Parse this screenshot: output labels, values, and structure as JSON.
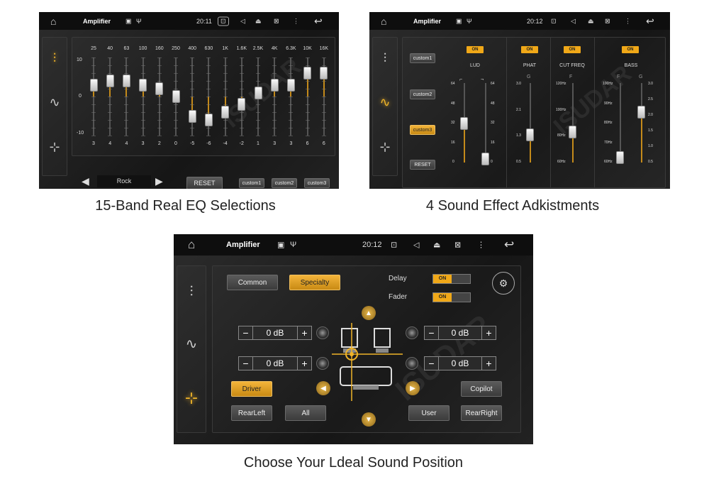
{
  "colors": {
    "accent": "#f0a818",
    "background": "#1c1c1c"
  },
  "panel1": {
    "status": {
      "title": "Amplifier",
      "time": "20:11",
      "home_icon": "home-icon",
      "back_icon": "back-icon"
    },
    "eq": {
      "frequencies": [
        "25",
        "40",
        "63",
        "100",
        "160",
        "250",
        "400",
        "630",
        "1K",
        "1.6K",
        "2.5K",
        "4K",
        "6.3K",
        "10K",
        "16K"
      ],
      "values": [
        3,
        4,
        4,
        3,
        2,
        0,
        -5,
        -6,
        -4,
        -2,
        1,
        3,
        3,
        6,
        6
      ],
      "value_labels": [
        "3",
        "4",
        "4",
        "3",
        "2",
        "0",
        "-5",
        "-6",
        "-4",
        "-2",
        "1",
        "3",
        "3",
        "6",
        "6"
      ],
      "scale": {
        "max": "10",
        "mid": "0",
        "min": "-10"
      },
      "range": [
        -10,
        10
      ]
    },
    "preset": {
      "name": "Rock",
      "reset": "RESET",
      "custom1": "custom1",
      "custom2": "custom2",
      "custom3": "custom3"
    }
  },
  "panel2": {
    "status": {
      "title": "Amplifier",
      "time": "20:12"
    },
    "presets": [
      "custom1",
      "custom2",
      "custom3"
    ],
    "selected_preset": "custom3",
    "reset": "RESET",
    "sections": [
      {
        "badge": "ON",
        "label": "LUD"
      },
      {
        "badge": "ON",
        "label": "PHAT",
        "sub": "G"
      },
      {
        "badge": "ON",
        "label": "CUT FREQ",
        "sub": "F"
      },
      {
        "badge": "ON",
        "label": "BASS",
        "sub_f": "F",
        "sub_g": "G"
      }
    ],
    "lud_scale": [
      "64",
      "48",
      "32",
      "16",
      "0"
    ],
    "phat_scale": [
      "3.0",
      "2.1",
      "1.3",
      "0.5"
    ],
    "cut_scale": [
      "120Hz",
      "100Hz",
      "80Hz",
      "60Hz"
    ],
    "bass_f_scale": [
      "100Hz",
      "90Hz",
      "80Hz",
      "70Hz",
      "60Hz"
    ],
    "bass_g_scale": [
      "3.0",
      "2.5",
      "2.0",
      "1.5",
      "1.0",
      "0.5"
    ]
  },
  "panel3": {
    "status": {
      "title": "Amplifier",
      "time": "20:12"
    },
    "tabs": {
      "common": "Common",
      "specialty": "Specialty"
    },
    "delay": {
      "label": "Delay",
      "state": "ON"
    },
    "fader": {
      "label": "Fader",
      "state": "ON"
    },
    "gains": {
      "front_left": "0 dB",
      "front_right": "0 dB",
      "rear_left": "0 dB",
      "rear_right": "0 dB"
    },
    "positions": {
      "driver": "Driver",
      "copilot": "Copilot",
      "rear_left": "RearLeft",
      "all": "All",
      "user": "User",
      "rear_right": "RearRight"
    },
    "minus": "−",
    "plus": "+"
  },
  "captions": {
    "c1": "15-Band Real EQ Selections",
    "c2": "4 Sound Effect Adkistments",
    "c3": "Choose Your Ldeal Sound Position"
  },
  "watermark": "ISUDAR"
}
